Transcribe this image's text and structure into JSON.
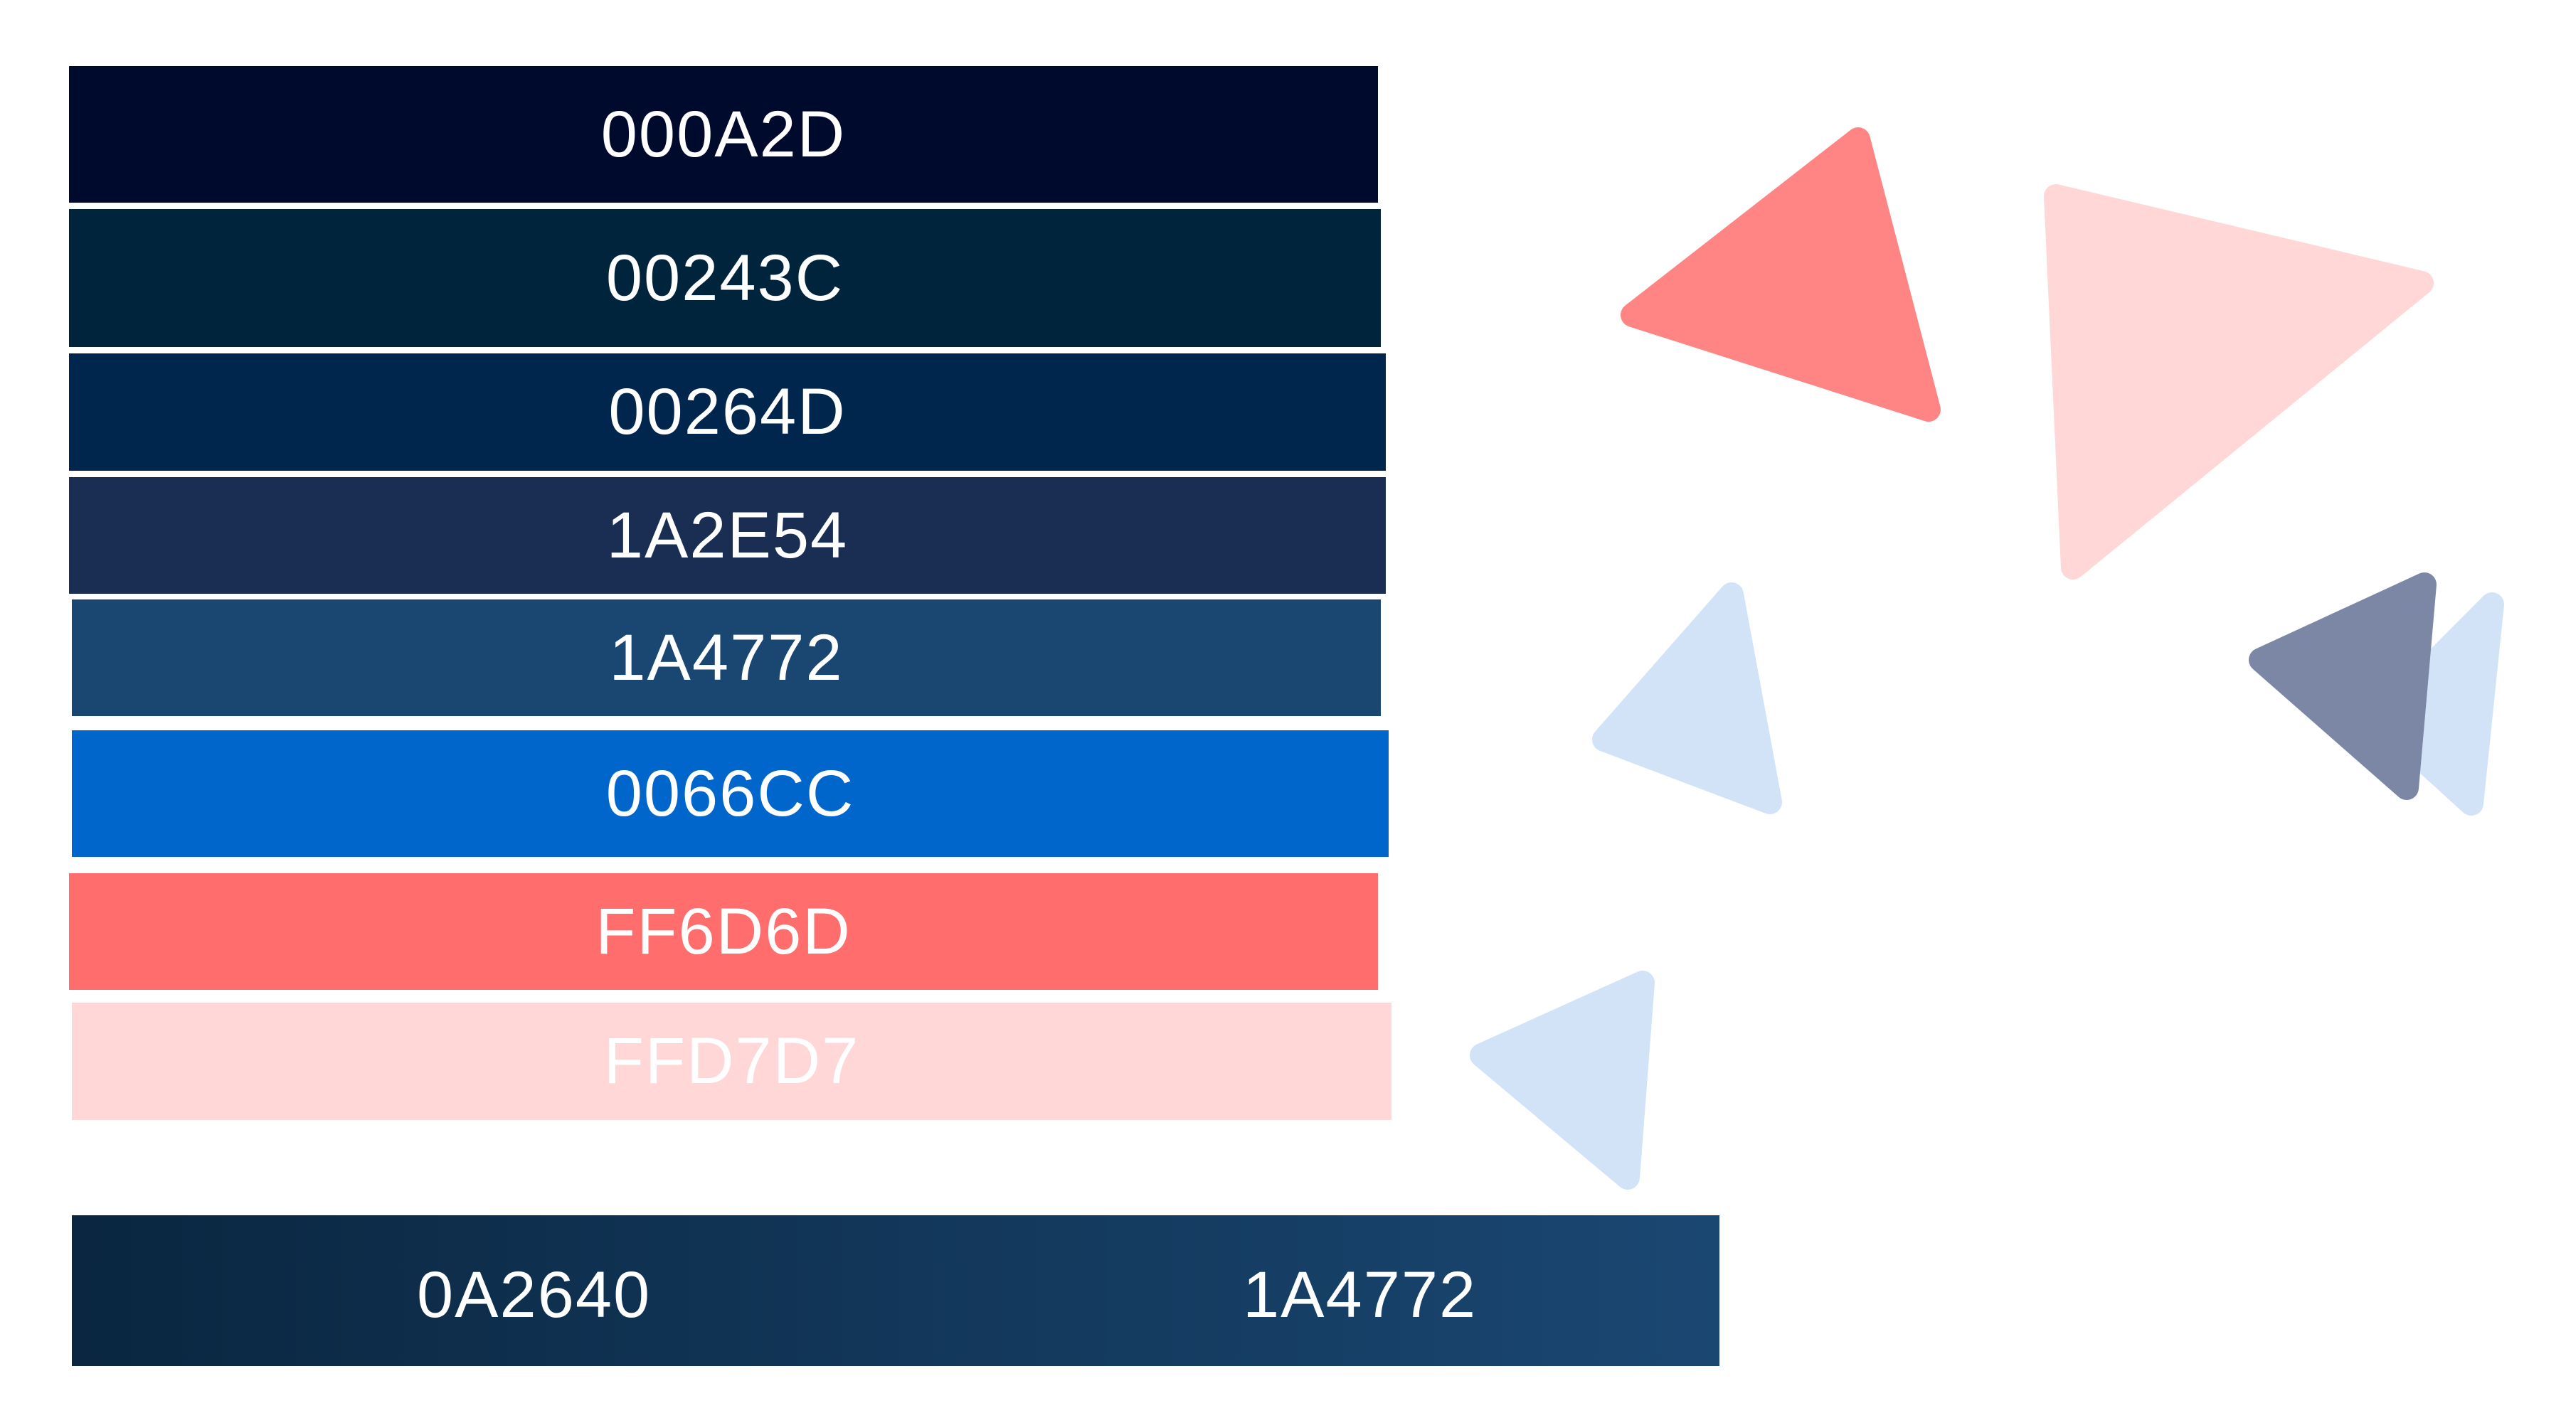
{
  "palette": {
    "swatches": [
      {
        "label": "000A2D",
        "color": "#000A2D"
      },
      {
        "label": "00243C",
        "color": "#00243C"
      },
      {
        "label": "00264D",
        "color": "#00264D"
      },
      {
        "label": "1A2E54",
        "color": "#1A2E54"
      },
      {
        "label": "1A4772",
        "color": "#1A4772"
      },
      {
        "label": "0066CC",
        "color": "#0066CC"
      },
      {
        "label": "FF6D6D",
        "color": "#FF6D6D"
      },
      {
        "label": "FFD7D7",
        "color": "#FFD7D7"
      }
    ],
    "gradient": {
      "start_label": "0A2640",
      "end_label": "1A4772",
      "start_color": "#0A2640",
      "end_color": "#1A4772"
    }
  },
  "decorations": {
    "shape": "rounded-triangle-icon",
    "colors": [
      "#FF8585",
      "#FFD7D7",
      "#D2E3F8",
      "#7C87A6"
    ]
  }
}
